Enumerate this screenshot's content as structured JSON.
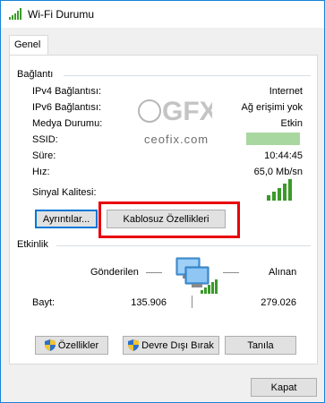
{
  "window": {
    "title": "Wi-Fi Durumu"
  },
  "tabs": [
    {
      "label": "Genel"
    }
  ],
  "connection": {
    "section_label": "Bağlantı",
    "rows": [
      {
        "label": "IPv4 Bağlantısı:",
        "value": "Internet"
      },
      {
        "label": "IPv6 Bağlantısı:",
        "value": "Ağ erişimi yok"
      },
      {
        "label": "Medya Durumu:",
        "value": "Etkin"
      },
      {
        "label": "SSID:",
        "value": ""
      },
      {
        "label": "Süre:",
        "value": "10:44:45"
      },
      {
        "label": "Hız:",
        "value": "65,0 Mb/sn"
      }
    ],
    "signal_label": "Sinyal Kalitesi:",
    "signal_bars_lit": 5,
    "signal_bars_total": 5,
    "details_button": "Ayrıntılar...",
    "wireless_props_button": "Kablosuz Özellikleri"
  },
  "activity": {
    "section_label": "Etkinlik",
    "sent_label": "Gönderilen",
    "received_label": "Alınan",
    "bytes_label": "Bayt:",
    "sent_value": "135.906",
    "received_value": "279.026"
  },
  "actions": {
    "properties_button": "Özellikler",
    "disable_button": "Devre Dışı Bırak",
    "diagnose_button": "Tanıla"
  },
  "footer": {
    "close_button": "Kapat"
  },
  "watermark": {
    "logo_text": "GFX",
    "site_text": "ceofix.com"
  },
  "colors": {
    "accent": "#0078d7",
    "highlight": "#e8000b",
    "signal_green": "#3a9a2a",
    "ssid_mask": "#a8d8a0"
  }
}
